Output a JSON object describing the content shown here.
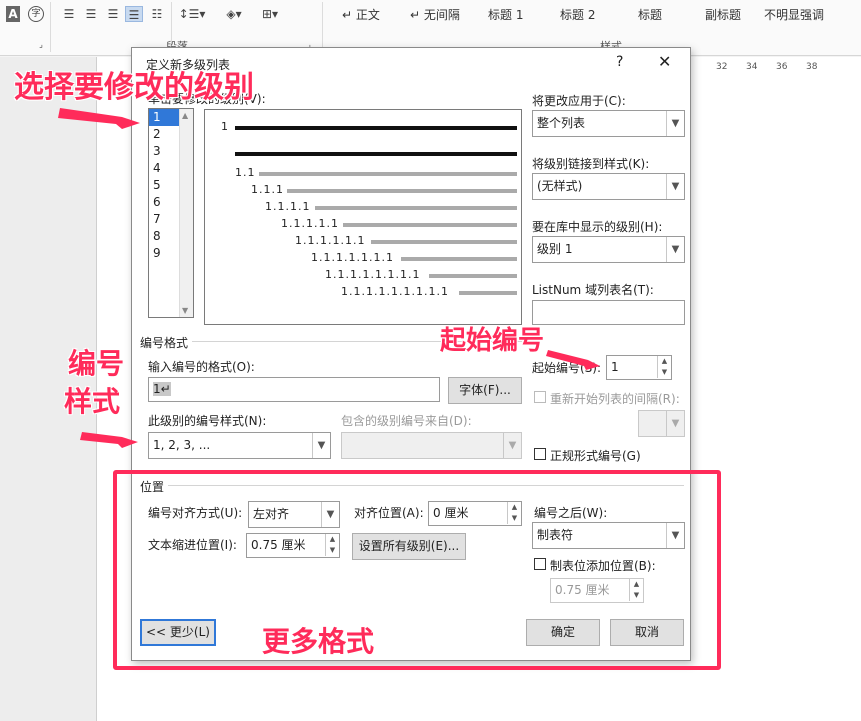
{
  "ribbon": {
    "icons": [
      "font-color-icon",
      "phonetic-guide-icon",
      "align-left-icon",
      "align-center-icon",
      "align-right-icon",
      "justify-icon",
      "distributed-icon",
      "line-spacing-icon",
      "shading-icon",
      "borders-icon"
    ],
    "group_paragraph": "段落",
    "group_styles": "样式",
    "styles": [
      "↵ 正文",
      "↵ 无间隔",
      "标题 1",
      "标题 2",
      "标题",
      "副标题",
      "不明显强调"
    ]
  },
  "ruler": [
    "32",
    "34",
    "36",
    "38"
  ],
  "dialog": {
    "title": "定义新多级列表",
    "help": "?",
    "close": "✕",
    "click_level_label": "单击要修改的级别(V):",
    "levels": [
      "1",
      "2",
      "3",
      "4",
      "5",
      "6",
      "7",
      "8",
      "9"
    ],
    "selected_level": "1",
    "preview_numbers": [
      "1",
      "1.1",
      "1.1.1",
      "1.1.1.1",
      "1.1.1.1.1",
      "1.1.1.1.1.1",
      "1.1.1.1.1.1.1",
      "1.1.1.1.1.1.1.1",
      "1.1.1.1.1.1.1.1.1"
    ],
    "apply_to_label": "将更改应用于(C):",
    "apply_to_value": "整个列表",
    "link_style_label": "将级别链接到样式(K):",
    "link_style_value": "(无样式)",
    "gallery_level_label": "要在库中显示的级别(H):",
    "gallery_level_value": "级别 1",
    "listnum_label": "ListNum 域列表名(T):",
    "listnum_value": "",
    "number_format_section": "编号格式",
    "enter_format_label": "输入编号的格式(O):",
    "enter_format_value": "1↵",
    "font_button": "字体(F)...",
    "number_style_label": "此级别的编号样式(N):",
    "number_style_value": "1, 2, 3, ...",
    "include_from_label": "包含的级别编号来自(D):",
    "start_at_label": "起始编号(S):",
    "start_at_value": "1",
    "restart_label": "重新开始列表的间隔(R):",
    "legal_label": "正规形式编号(G)",
    "position_section": "位置",
    "alignment_label": "编号对齐方式(U):",
    "alignment_value": "左对齐",
    "aligned_at_label": "对齐位置(A):",
    "aligned_at_value": "0 厘米",
    "follow_label": "编号之后(W):",
    "follow_value": "制表符",
    "text_indent_label": "文本缩进位置(I):",
    "text_indent_value": "0.75 厘米",
    "set_all_button": "设置所有级别(E)...",
    "tab_stop_label": "制表位添加位置(B):",
    "tab_stop_value": "0.75 厘米",
    "less_button": "<< 更少(L)",
    "ok_button": "确定",
    "cancel_button": "取消"
  },
  "annotations": {
    "select_level": "选择要修改的级别",
    "start_number": "起始编号",
    "numbering_style_1": "编号",
    "numbering_style_2": "样式",
    "more_format": "更多格式"
  },
  "colors": {
    "annotation": "#ff2b5a",
    "selection": "#3078d8"
  }
}
